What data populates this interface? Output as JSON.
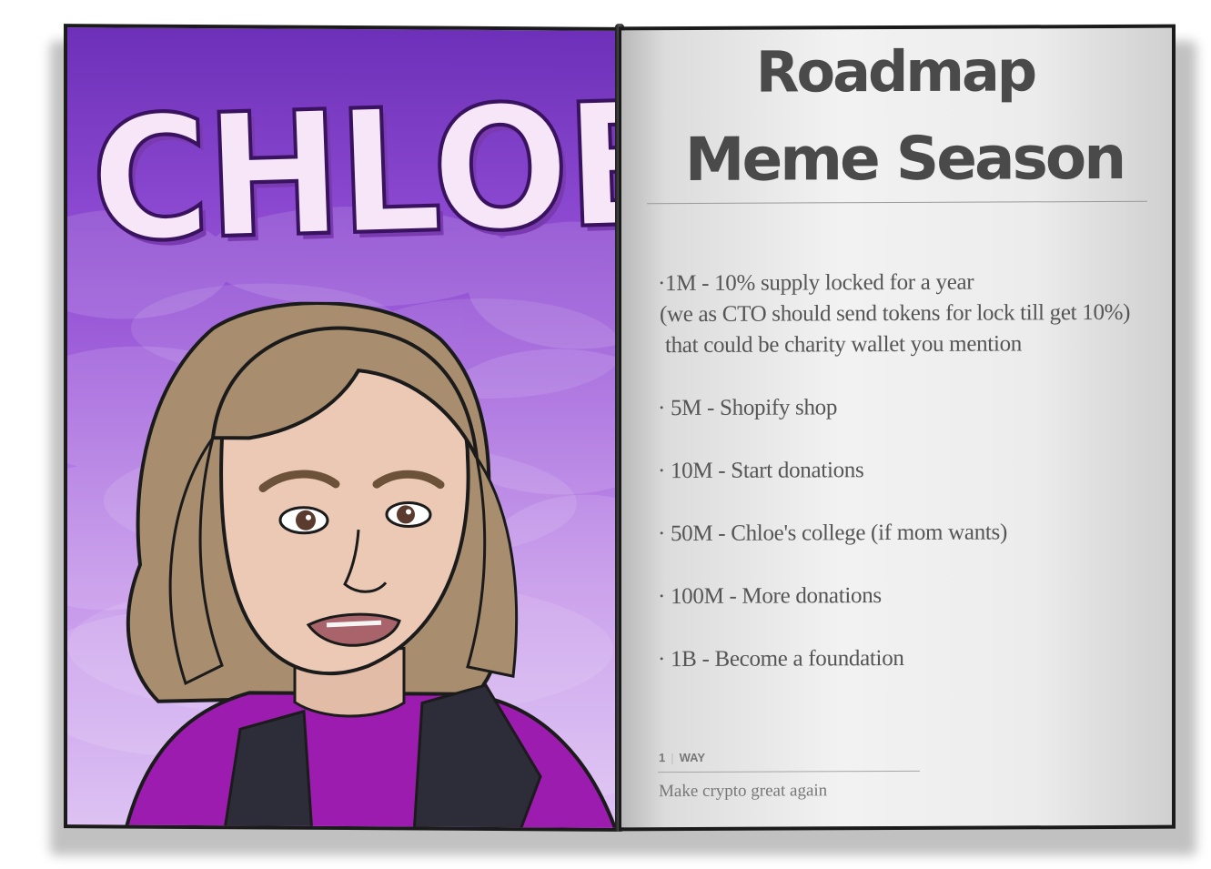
{
  "cover": {
    "title": "CHLOE"
  },
  "roadmap": {
    "title_line1": "Roadmap",
    "title_line2": "Meme Season",
    "items": [
      "·1M - 10% supply locked for a year",
      "(we as CTO should send tokens for lock till get 10%)",
      " that could be charity wallet you mention",
      "· 5M - Shopify shop",
      "· 10M - Start donations",
      "· 50M - Chloe's college (if mom wants)",
      "· 100M - More donations",
      "· 1B - Become a foundation"
    ]
  },
  "footer": {
    "page_number": "1",
    "section": "WAY",
    "tagline": "Make crypto great again"
  },
  "colors": {
    "cover_purple": "#7a3bb0",
    "cover_title": "#f6e6f8",
    "page_text": "#555555",
    "jacket_purple": "#9c1cb0",
    "hair": "#a88e6f"
  }
}
